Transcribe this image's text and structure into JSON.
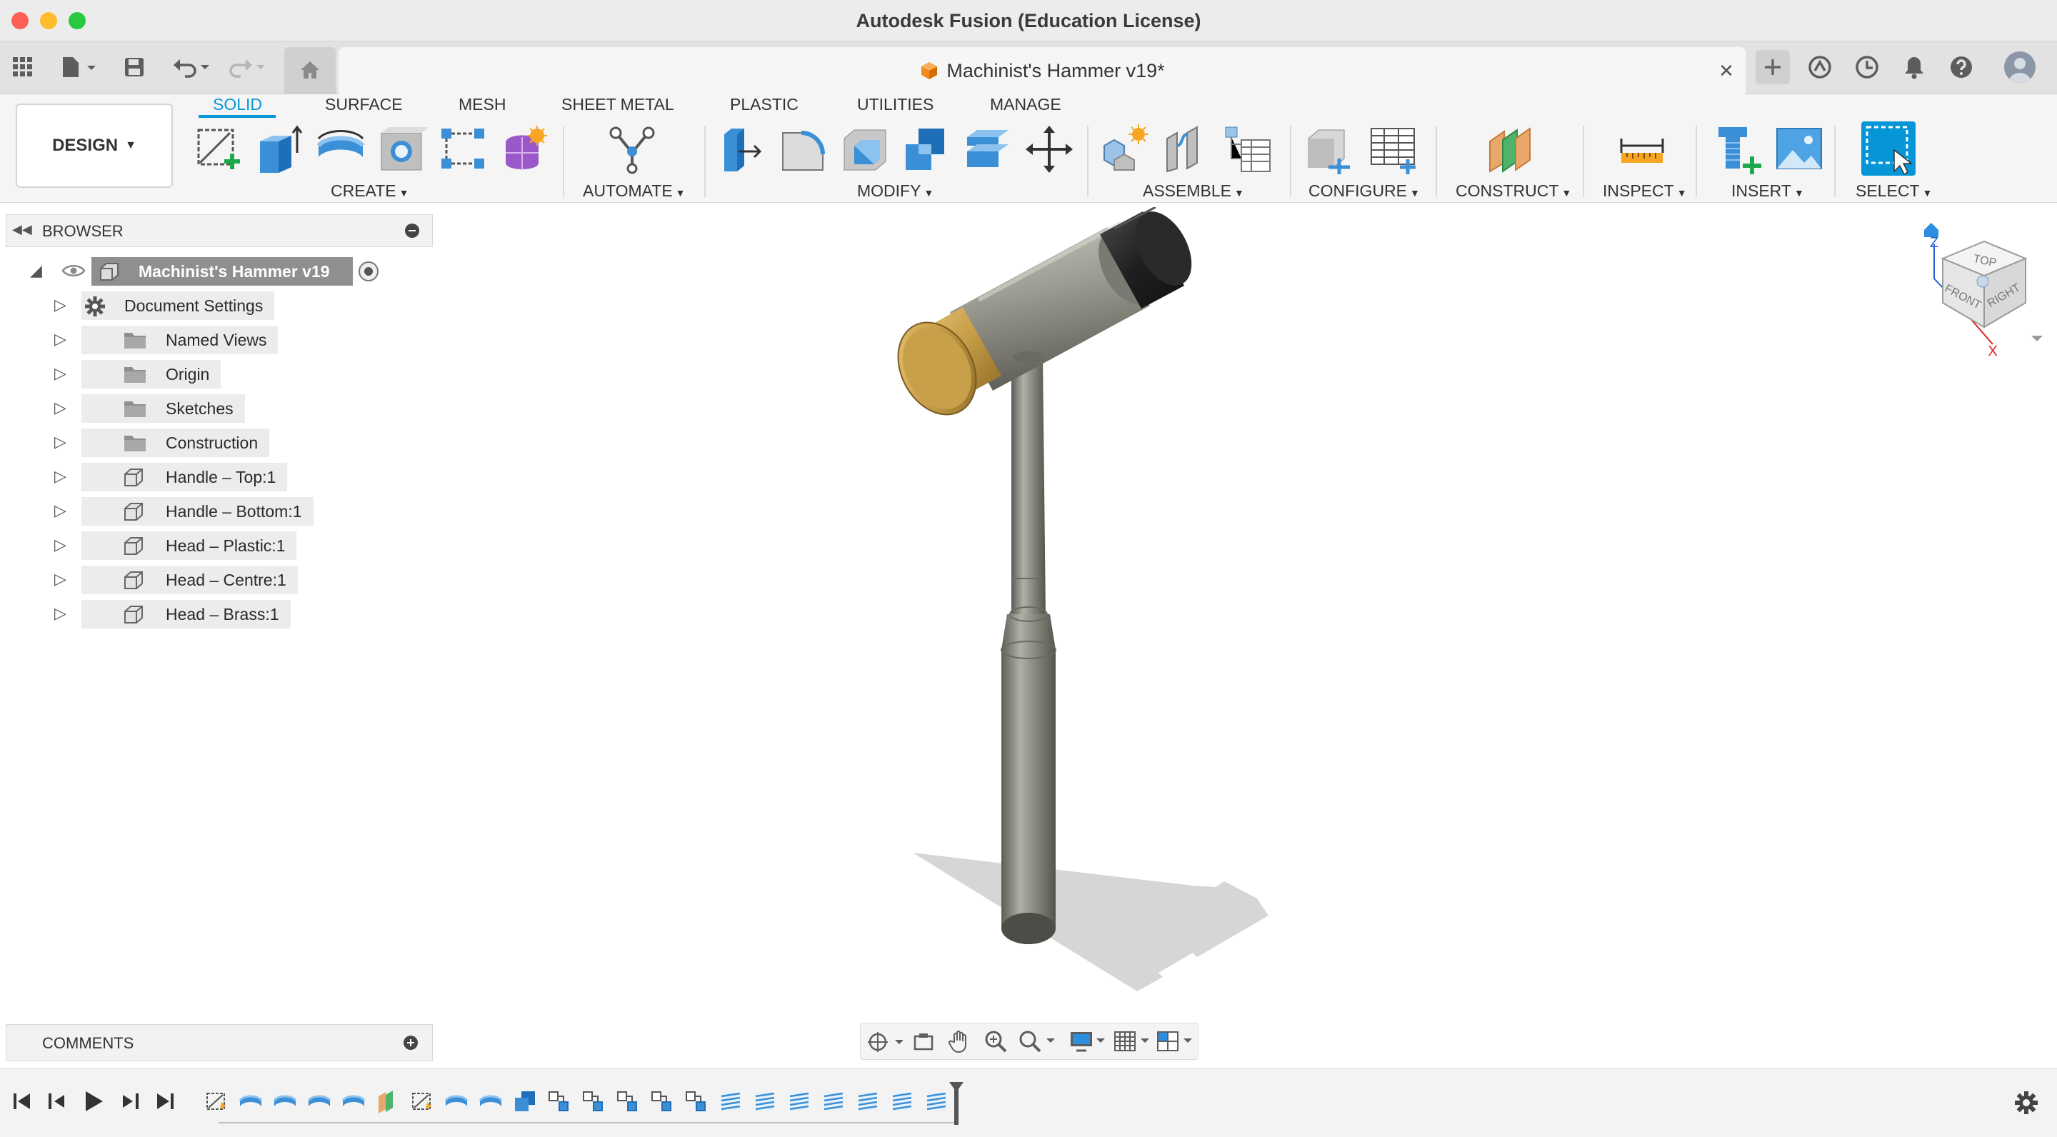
{
  "colors": {
    "accent": "#0696d7",
    "close_light": "#fe5f57",
    "minimize_light": "#febc2e",
    "zoom_light": "#28c840"
  },
  "window": {
    "title": "Autodesk Fusion (Education License)"
  },
  "document_tab": {
    "title": "Machinist's Hammer v19*",
    "close": "✕"
  },
  "ribbon": {
    "workspace": "DESIGN",
    "tabs": [
      "SOLID",
      "SURFACE",
      "MESH",
      "SHEET METAL",
      "PLASTIC",
      "UTILITIES",
      "MANAGE"
    ],
    "groups": [
      "CREATE",
      "AUTOMATE",
      "MODIFY",
      "ASSEMBLE",
      "CONFIGURE",
      "CONSTRUCT",
      "INSPECT",
      "INSERT",
      "SELECT"
    ]
  },
  "browser": {
    "title": "BROWSER",
    "root": "Machinist's Hammer v19",
    "items": [
      {
        "label": "Document Settings",
        "icon": "gear-icon"
      },
      {
        "label": "Named Views",
        "icon": "folder-icon"
      },
      {
        "label": "Origin",
        "icon": "folder-icon",
        "hidden": true
      },
      {
        "label": "Sketches",
        "icon": "folder-icon"
      },
      {
        "label": "Construction",
        "icon": "folder-icon"
      },
      {
        "label": "Handle – Top:1",
        "icon": "component-icon"
      },
      {
        "label": "Handle – Bottom:1",
        "icon": "component-icon"
      },
      {
        "label": "Head – Plastic:1",
        "icon": "component-icon"
      },
      {
        "label": "Head – Centre:1",
        "icon": "component-icon"
      },
      {
        "label": "Head – Brass:1",
        "icon": "component-icon"
      }
    ]
  },
  "comments": {
    "title": "COMMENTS"
  },
  "viewcube": {
    "top": "TOP",
    "front": "FRONT",
    "right": "RIGHT",
    "z_axis": "Z",
    "x_axis": "X"
  },
  "timeline": {
    "feature_count": 22
  }
}
